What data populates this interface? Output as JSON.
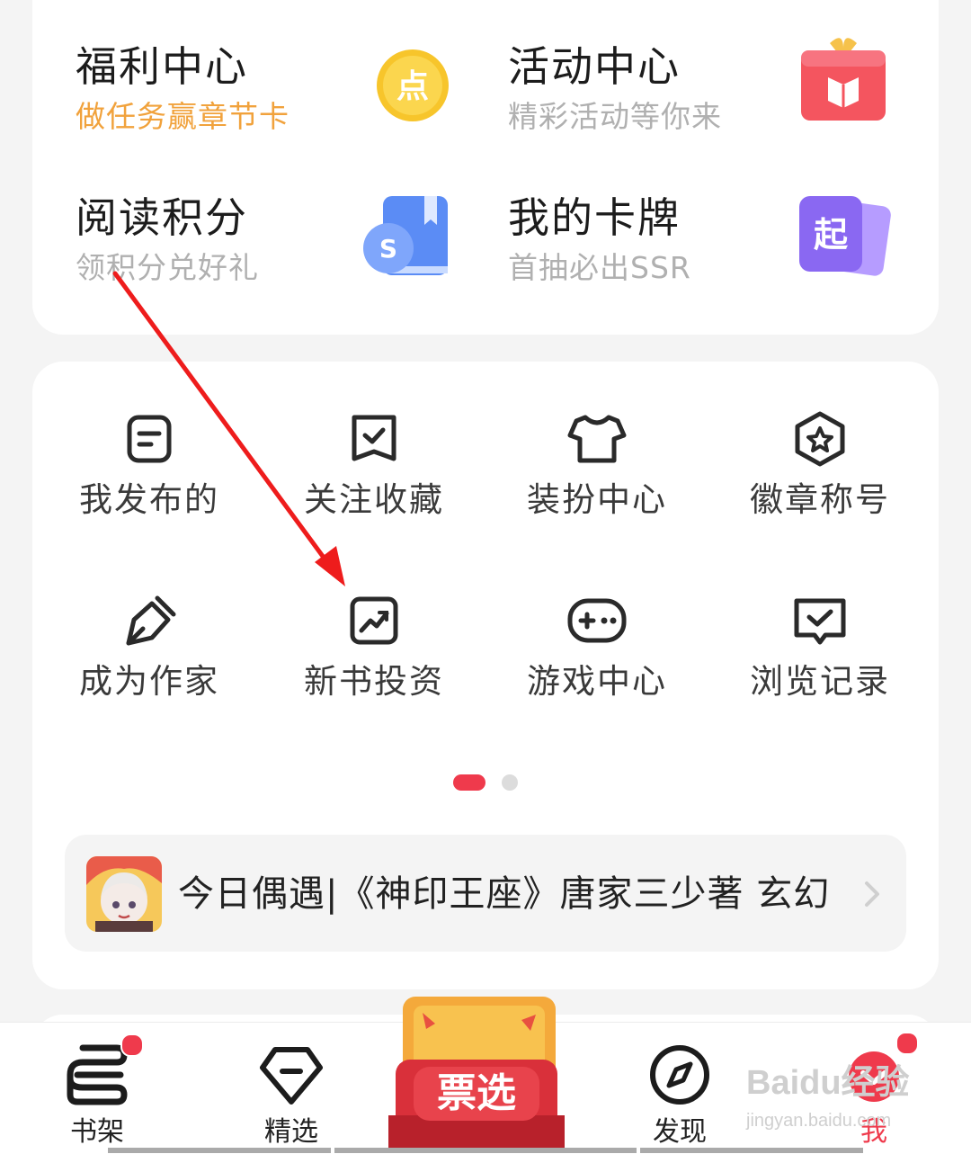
{
  "benefits": {
    "welfare": {
      "title": "福利中心",
      "subtitle": "做任务赢章节卡",
      "icon": "gold-coin-icon",
      "art_text": "点"
    },
    "activity": {
      "title": "活动中心",
      "subtitle": "精彩活动等你来",
      "icon": "gift-box-icon"
    },
    "points": {
      "title": "阅读积分",
      "subtitle": "领积分兑好礼",
      "icon": "book-coin-icon",
      "art_text": "S"
    },
    "cards": {
      "title": "我的卡牌",
      "subtitle": "首抽必出SSR",
      "icon": "card-deck-icon",
      "art_text": "起"
    }
  },
  "grid": [
    {
      "label": "我发布的",
      "icon": "document-icon"
    },
    {
      "label": "关注收藏",
      "icon": "bookmark-check-icon"
    },
    {
      "label": "装扮中心",
      "icon": "tshirt-icon"
    },
    {
      "label": "徽章称号",
      "icon": "badge-star-icon"
    },
    {
      "label": "成为作家",
      "icon": "pen-nib-icon"
    },
    {
      "label": "新书投资",
      "icon": "trend-chart-icon"
    },
    {
      "label": "游戏中心",
      "icon": "gamepad-icon"
    },
    {
      "label": "浏览记录",
      "icon": "history-book-icon"
    }
  ],
  "pagination": {
    "pages": 2,
    "current": 1
  },
  "recommend": {
    "text": "今日偶遇|《神印王座》唐家三少著 玄幻",
    "avatar": "anime-avatar"
  },
  "tabbar": {
    "items": [
      {
        "label": "书架",
        "icon": "bookshelf-icon",
        "badge": true,
        "active": false
      },
      {
        "label": "精选",
        "icon": "diamond-icon",
        "badge": false,
        "active": false
      },
      {
        "label": "发现",
        "icon": "compass-icon",
        "badge": false,
        "active": false
      },
      {
        "label": "我",
        "icon": "profile-icon",
        "badge": true,
        "active": true
      }
    ],
    "promo_text": "票选"
  },
  "watermark": {
    "main": "Baidu经验",
    "sub": "jingyan.baidu.com"
  },
  "colors": {
    "accent": "#ef3a4c",
    "orange": "#f1a23c",
    "annotation": "#ee1c1c"
  }
}
